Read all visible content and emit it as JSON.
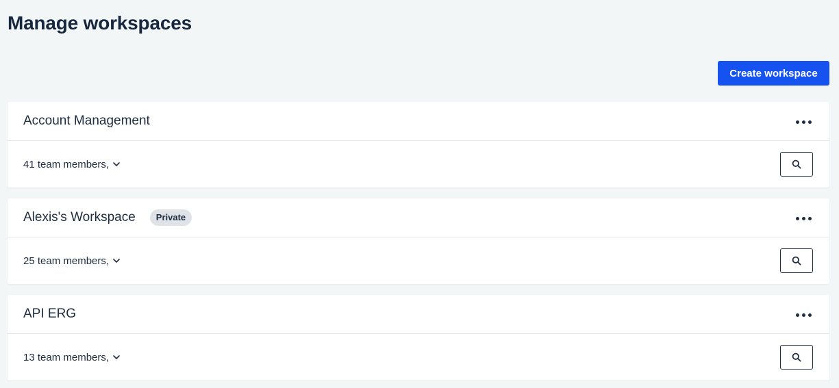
{
  "page": {
    "title": "Manage workspaces"
  },
  "actions": {
    "create_label": "Create workspace"
  },
  "colors": {
    "accent": "#1652f0",
    "background": "#f3f6f7",
    "badge": "#dfe2e6"
  },
  "workspaces": [
    {
      "name": "Account Management",
      "badge": "",
      "members": "41 team members,"
    },
    {
      "name": "Alexis's Workspace",
      "badge": "Private",
      "members": "25 team members,"
    },
    {
      "name": "API ERG",
      "badge": "",
      "members": "13 team members,"
    }
  ],
  "icons": {
    "more": "more-horizontal-icon",
    "search": "search-icon",
    "expand": "chevron-down-icon"
  }
}
